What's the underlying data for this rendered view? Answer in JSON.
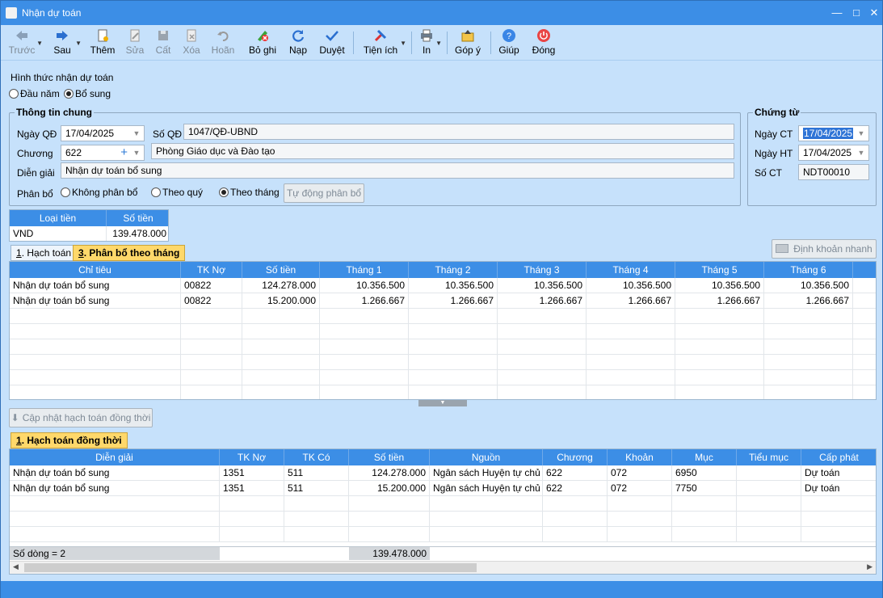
{
  "window": {
    "title": "Nhận dự toán"
  },
  "toolbar": {
    "back": "Trước",
    "next": "Sau",
    "add": "Thêm",
    "edit": "Sửa",
    "save": "Cất",
    "delete": "Xóa",
    "undo": "Hoãn",
    "unpost": "Bỏ ghi",
    "reload": "Nạp",
    "approve": "Duyệt",
    "utilities": "Tiện ích",
    "print": "In",
    "feedback": "Góp ý",
    "help": "Giúp",
    "close": "Đóng"
  },
  "form": {
    "receive_type_label": "Hình thức nhận dự toán",
    "radio_start_year": "Đầu năm",
    "radio_supplement": "Bổ sung",
    "general_info_title": "Thông tin chung",
    "decision_date_label": "Ngày QĐ",
    "decision_date": "17/04/2025",
    "decision_no_label": "Số QĐ",
    "decision_no": "1047/QĐ-UBND",
    "chapter_label": "Chương",
    "chapter_code": "622",
    "chapter_name": "Phòng Giáo dục và Đào tạo",
    "description_label": "Diễn giải",
    "description": "Nhận dự toán bổ sung",
    "allocation_label": "Phân bổ",
    "alloc_none": "Không phân bổ",
    "alloc_quarter": "Theo quý",
    "alloc_month": "Theo tháng",
    "auto_allocate_button": "Tự động phân bổ"
  },
  "voucher": {
    "title": "Chứng từ",
    "voucher_date_label": "Ngày CT",
    "voucher_date": "17/04/2025",
    "posting_date_label": "Ngày HT",
    "posting_date": "17/04/2025",
    "voucher_no_label": "Số CT",
    "voucher_no": "NDT00010"
  },
  "currency_table": {
    "headers": [
      "Loại tiền",
      "Số tiền"
    ],
    "rows": [
      [
        "VND",
        "139.478.000"
      ]
    ]
  },
  "tabs": {
    "accounting": "Hạch toán",
    "accounting_key": "1",
    "monthly": "Phân bổ theo tháng",
    "monthly_key": "3"
  },
  "quick_entry_button": "Định khoản nhanh",
  "monthly_grid": {
    "headers": [
      "Chỉ tiêu",
      "TK Nợ",
      "Số tiền",
      "Tháng 1",
      "Tháng 2",
      "Tháng 3",
      "Tháng 4",
      "Tháng 5",
      "Tháng 6"
    ],
    "rows": [
      [
        "Nhận dự toán bổ sung",
        "00822",
        "124.278.000",
        "10.356.500",
        "10.356.500",
        "10.356.500",
        "10.356.500",
        "10.356.500",
        "10.356.500"
      ],
      [
        "Nhận dự toán bổ sung",
        "00822",
        "15.200.000",
        "1.266.667",
        "1.266.667",
        "1.266.667",
        "1.266.667",
        "1.266.667",
        "1.266.667"
      ]
    ]
  },
  "update_button": "Cập nhật hạch toán đồng thời",
  "simul_tab": {
    "key": "1",
    "label": "Hạch toán đồng thời"
  },
  "simul_grid": {
    "headers": [
      "Diễn giải",
      "TK Nợ",
      "TK Có",
      "Số tiền",
      "Nguồn",
      "Chương",
      "Khoản",
      "Mục",
      "Tiểu mục",
      "Cấp phát"
    ],
    "rows": [
      [
        "Nhận dự toán bổ sung",
        "1351",
        "511",
        "124.278.000",
        "Ngân sách Huyện tự chủ",
        "622",
        "072",
        "6950",
        "",
        "Dự toán"
      ],
      [
        "Nhận dự toán bổ sung",
        "1351",
        "511",
        "15.200.000",
        "Ngân sách Huyện tự chủ",
        "622",
        "072",
        "7750",
        "",
        "Dự toán"
      ]
    ],
    "footer_count": "Số dòng = 2",
    "footer_total": "139.478.000"
  }
}
